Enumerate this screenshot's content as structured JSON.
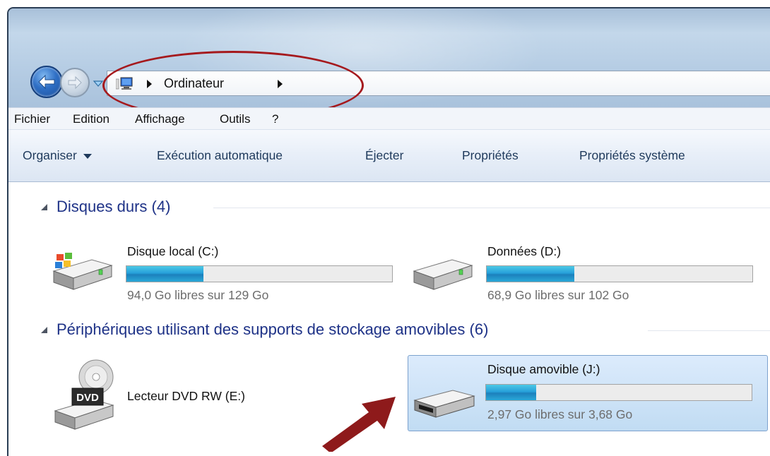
{
  "address": {
    "location": "Ordinateur",
    "icon": "computer-icon"
  },
  "menu": {
    "items": [
      "Fichier",
      "Edition",
      "Affichage",
      "Outils",
      "?"
    ]
  },
  "toolbar": {
    "organise_label": "Organiser",
    "autoplay_label": "Exécution automatique",
    "eject_label": "Éjecter",
    "properties_label": "Propriétés",
    "system_properties_label": "Propriétés système"
  },
  "groups": {
    "hard_disks": {
      "title": "Disques durs (4)",
      "drives": [
        {
          "name": "Disque local (C:)",
          "free_text": "94,0 Go libres sur 129 Go",
          "used_fraction": 0.29,
          "icon": "windows-hard-drive-icon"
        },
        {
          "name": "Données (D:)",
          "free_text": "68,9 Go libres sur 102 Go",
          "used_fraction": 0.33,
          "icon": "hard-drive-icon"
        }
      ]
    },
    "removable": {
      "title": "Périphériques utilisant des supports de stockage amovibles (6)",
      "drives": [
        {
          "name": "Lecteur DVD RW (E:)",
          "icon": "dvd-drive-icon"
        },
        {
          "name": "Disque amovible (J:)",
          "free_text": "2,97 Go libres sur 3,68 Go",
          "used_fraction": 0.19,
          "icon": "removable-drive-icon"
        }
      ]
    }
  },
  "dvd_label": "DVD",
  "colors": {
    "group_title": "#1e3287",
    "annotation": "#a5191d",
    "selection": "#c1dcf3",
    "bar_fill": "#26a0da"
  }
}
